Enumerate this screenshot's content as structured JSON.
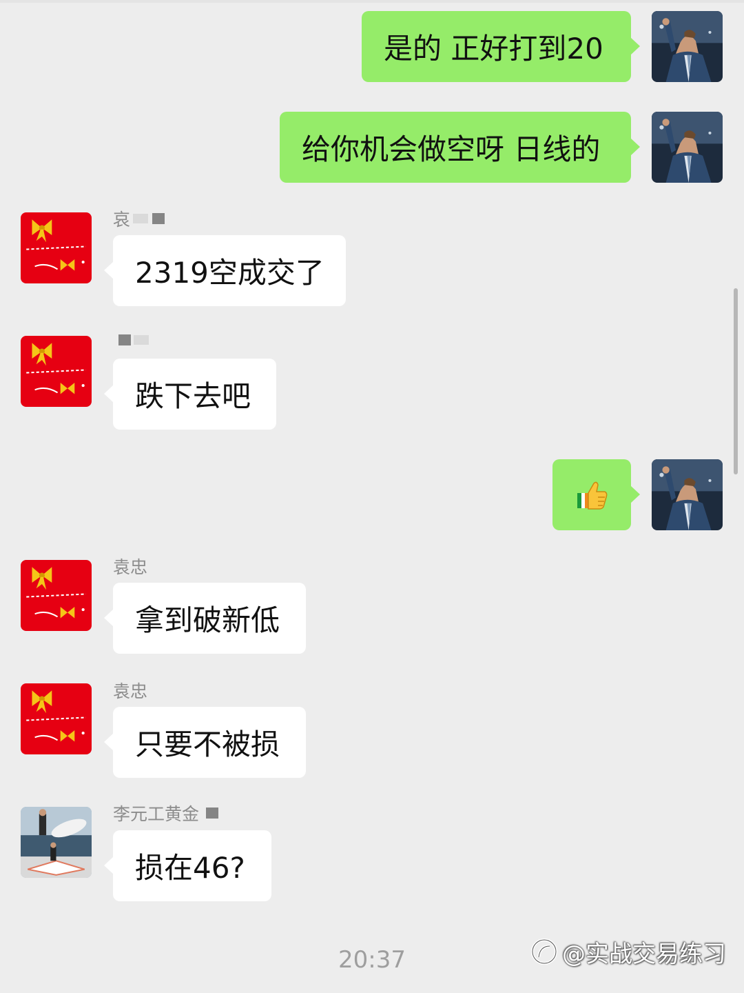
{
  "chat": {
    "messages": [
      {
        "side": "me",
        "text": "是的 正好打到20"
      },
      {
        "side": "me",
        "text": "给你机会做空呀 日线的"
      },
      {
        "side": "other",
        "sender": "哀",
        "text": "2319空成交了"
      },
      {
        "side": "other",
        "sender": "",
        "text": "跌下去吧"
      },
      {
        "side": "me",
        "emoji": "thumbs-up"
      },
      {
        "side": "other",
        "sender": "袁忠",
        "text": "拿到破新低"
      },
      {
        "side": "other",
        "sender": "袁忠",
        "text": "只要不被损"
      },
      {
        "side": "other",
        "sender": "李元工黄金",
        "text": "损在46?"
      }
    ],
    "timestamp": "20:37"
  },
  "watermark": {
    "text": "@实战交易练习",
    "icon": "toutiao-logo-icon"
  },
  "colors": {
    "background": "#ededed",
    "my_bubble": "#95ec69",
    "other_bubble": "#ffffff",
    "red_avatar": "#e60012",
    "timestamp": "#9e9e9e"
  }
}
